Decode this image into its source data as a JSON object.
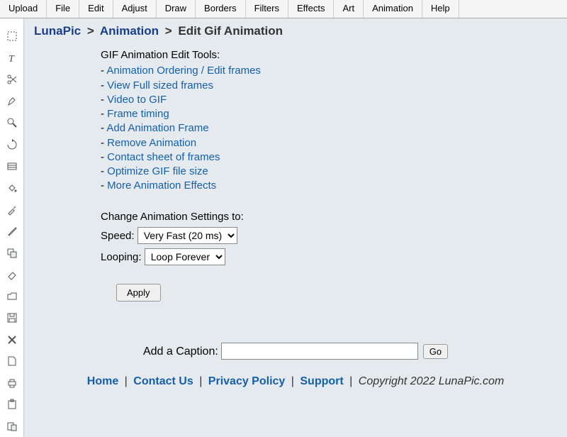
{
  "menubar": [
    "Upload",
    "File",
    "Edit",
    "Adjust",
    "Draw",
    "Borders",
    "Filters",
    "Effects",
    "Art",
    "Animation",
    "Help"
  ],
  "breadcrumb": {
    "site": "LunaPic",
    "section": "Animation",
    "page": "Edit Gif Animation",
    "sep": ">"
  },
  "tools": {
    "title": "GIF Animation Edit Tools:",
    "links": [
      "Animation Ordering / Edit frames",
      "View Full sized frames",
      "Video to GIF",
      "Frame timing",
      "Add Animation Frame",
      "Remove Animation",
      "Contact sheet of frames",
      "Optimize GIF file size",
      "More Animation Effects"
    ]
  },
  "settings": {
    "heading": "Change Animation Settings to:",
    "speed_label": "Speed:",
    "speed_value": "Very Fast (20 ms)",
    "looping_label": "Looping:",
    "looping_value": "Loop Forever",
    "apply_label": "Apply"
  },
  "caption": {
    "label": "Add a Caption:",
    "value": "",
    "go_label": "Go"
  },
  "footer": {
    "links": [
      "Home",
      "Contact Us",
      "Privacy Policy",
      "Support"
    ],
    "copyright": "Copyright 2022 LunaPic.com"
  },
  "sidebar_icons": [
    "select-icon",
    "text-icon",
    "scissors-icon",
    "pen-icon",
    "zoom-icon",
    "rotate-icon",
    "grid-icon",
    "bucket-icon",
    "eyedropper-icon",
    "brush-icon",
    "copy-icon",
    "erase-icon",
    "open-folder-icon",
    "save-icon",
    "close-icon",
    "document-icon",
    "print-icon",
    "paste-icon",
    "clipboard-icon"
  ]
}
